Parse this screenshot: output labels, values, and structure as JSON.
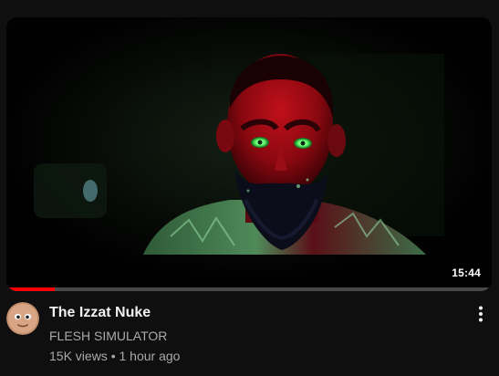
{
  "video": {
    "title": "The Izzat Nuke",
    "channel": "FLESH SIMULATOR",
    "views": "15K views",
    "separator": "•",
    "age": "1 hour ago",
    "duration": "15:44",
    "watch_progress_percent": 10
  },
  "icons": {
    "menu": "more-vert-icon",
    "avatar": "channel-avatar"
  },
  "colors": {
    "background": "#0f0f0f",
    "progress": "#ff0000",
    "title": "#f1f1f1",
    "secondary_text": "#aaaaaa"
  }
}
